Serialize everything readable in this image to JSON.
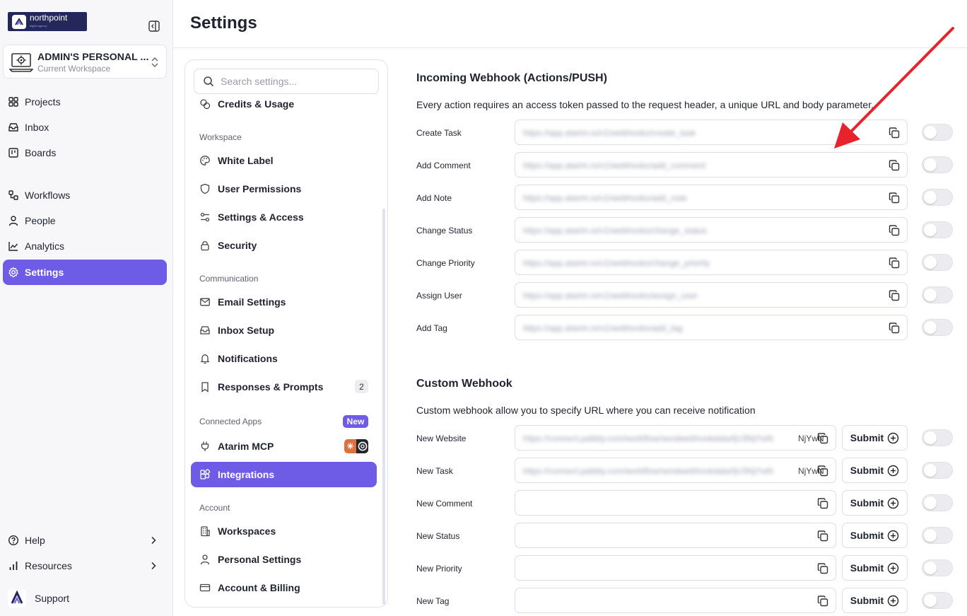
{
  "brand": {
    "name": "northpoint",
    "tagline": "digital agency"
  },
  "workspace": {
    "name": "ADMIN'S PERSONAL ...",
    "subtitle": "Current Workspace"
  },
  "nav": {
    "projects": "Projects",
    "inbox": "Inbox",
    "boards": "Boards",
    "workflows": "Workflows",
    "people": "People",
    "analytics": "Analytics",
    "settings": "Settings",
    "help": "Help",
    "resources": "Resources",
    "support": "Support"
  },
  "header": {
    "title": "Settings"
  },
  "settings_menu": {
    "search_placeholder": "Search settings...",
    "credits": "Credits & Usage",
    "group_workspace": "Workspace",
    "white_label": "White Label",
    "user_permissions": "User Permissions",
    "settings_access": "Settings & Access",
    "security": "Security",
    "group_communication": "Communication",
    "email_settings": "Email Settings",
    "inbox_setup": "Inbox Setup",
    "notifications": "Notifications",
    "responses_prompts": "Responses & Prompts",
    "responses_count": "2",
    "group_connected": "Connected Apps",
    "new_badge": "New",
    "atarim_mcp": "Atarim MCP",
    "integrations": "Integrations",
    "group_account": "Account",
    "workspaces": "Workspaces",
    "personal_settings": "Personal Settings",
    "account_billing": "Account & Billing"
  },
  "incoming": {
    "title": "Incoming Webhook (Actions/PUSH)",
    "description": "Every action requires an access token passed to the request header, a unique URL and body parameter.",
    "rows": [
      {
        "label": "Create Task",
        "value": "https://app.atarim.io/v1/webhooks/create_task"
      },
      {
        "label": "Add Comment",
        "value": "https://app.atarim.io/v1/webhooks/add_comment"
      },
      {
        "label": "Add Note",
        "value": "https://app.atarim.io/v1/webhooks/add_note"
      },
      {
        "label": "Change Status",
        "value": "https://app.atarim.io/v1/webhooks/change_status"
      },
      {
        "label": "Change Priority",
        "value": "https://app.atarim.io/v1/webhooks/change_priority"
      },
      {
        "label": "Assign User",
        "value": "https://app.atarim.io/v1/webhooks/assign_user"
      },
      {
        "label": "Add Tag",
        "value": "https://app.atarim.io/v1/webhooks/add_tag"
      }
    ]
  },
  "custom": {
    "title": "Custom Webhook",
    "description": "Custom webhook allow you to specify URL where you can receive notification",
    "submit_label": "Submit",
    "rows": [
      {
        "label": "New Website",
        "value": "https://connect.pabbly.com/workflow/sendwebhookdata/IjU3NjYwN",
        "tail": "NjYwN"
      },
      {
        "label": "New Task",
        "value": "https://connect.pabbly.com/workflow/sendwebhookdata/IjU3NjYwN",
        "tail": "NjYwN"
      },
      {
        "label": "New Comment",
        "value": "",
        "tail": ""
      },
      {
        "label": "New Status",
        "value": "",
        "tail": ""
      },
      {
        "label": "New Priority",
        "value": "",
        "tail": ""
      },
      {
        "label": "New Tag",
        "value": "",
        "tail": ""
      }
    ]
  },
  "colors": {
    "accent": "#6e5ce6",
    "annotation": "#e8232b",
    "brand_bg": "#23275a"
  }
}
